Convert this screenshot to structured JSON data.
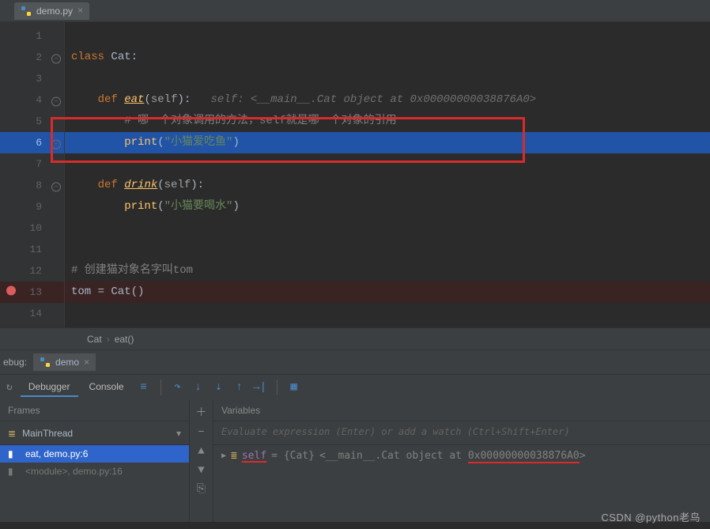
{
  "tab": {
    "filename": "demo.py"
  },
  "code": {
    "lines": [
      "",
      "class Cat:",
      "",
      "    def eat(self):   ",
      "        # 哪一个对象调用的方法，self就是哪一个对象的引用",
      "        print(\"小猫爱吃鱼\")",
      "",
      "    def drink(self):",
      "        print(\"小猫要喝水\")",
      "",
      "",
      "# 创建猫对象名字叫tom",
      "tom = Cat()",
      ""
    ],
    "inline_hint_line4": "self: <__main__.Cat object at 0x00000000038876A0>",
    "current_exec_line": 6,
    "breakpoint_line": 13
  },
  "breadcrumb": {
    "class": "Cat",
    "method": "eat()"
  },
  "debug": {
    "label": "ebug:",
    "run_config": "demo",
    "tabs": {
      "debugger": "Debugger",
      "console": "Console"
    },
    "frames_header": "Frames",
    "variables_header": "Variables",
    "thread": "MainThread",
    "frames": [
      {
        "label": "eat, demo.py:6",
        "selected": true
      },
      {
        "label": "<module>, demo.py:16",
        "selected": false
      }
    ],
    "eval_placeholder": "Evaluate expression (Enter) or add a watch (Ctrl+Shift+Enter)",
    "variable": {
      "name": "self",
      "type": "{Cat}",
      "value": "<__main__.Cat object at 0x00000000038876A0>"
    }
  },
  "watermark": "CSDN @python老鸟"
}
